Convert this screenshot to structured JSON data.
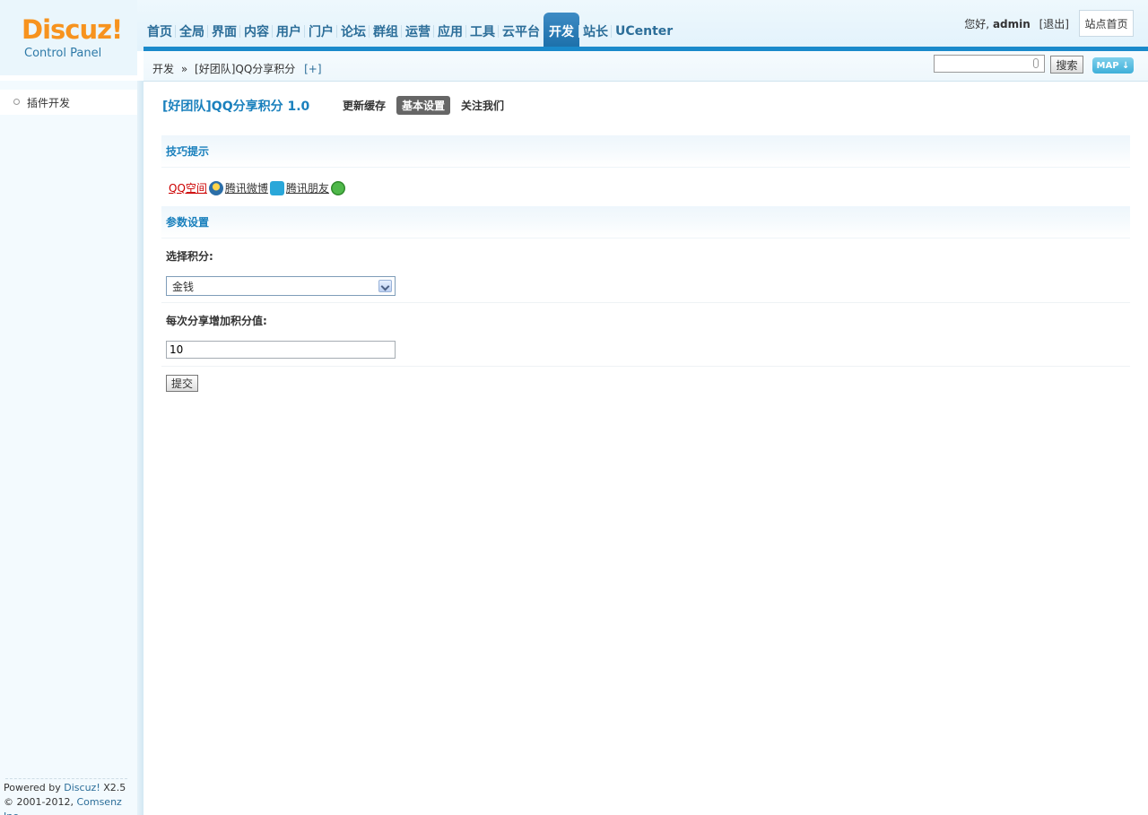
{
  "logo": {
    "name": "Discuz!",
    "subtitle": "Control Panel"
  },
  "nav": {
    "items": [
      "首页",
      "全局",
      "界面",
      "内容",
      "用户",
      "门户",
      "论坛",
      "群组",
      "运营",
      "应用",
      "工具",
      "云平台",
      "开发",
      "站长",
      "UCenter"
    ],
    "active_index": 12
  },
  "user": {
    "greeting": "您好,",
    "username": "admin",
    "logout": "[退出]",
    "site_home": "站点首页"
  },
  "breadcrumb": {
    "parent": "开发",
    "separator": "»",
    "current": "[好团队]QQ分享积分",
    "add": "[+]"
  },
  "search": {
    "value": "",
    "button": "搜索",
    "map_button": "MAP ↓"
  },
  "sidebar": {
    "items": [
      {
        "label": "插件开发"
      }
    ]
  },
  "footer": {
    "powered_prefix": "Powered by ",
    "powered_link": "Discuz!",
    "version": " X2.5",
    "copyright_prefix": "© 2001-2012, ",
    "copyright_link": "Comsenz Inc."
  },
  "plugin": {
    "title": "[好团队]QQ分享积分 1.0",
    "tabs": [
      {
        "label": "更新缓存"
      },
      {
        "label": "基本设置"
      },
      {
        "label": "关注我们"
      }
    ],
    "active_tab": 1
  },
  "tips": {
    "heading": "技巧提示",
    "links": [
      {
        "label": "QQ空间"
      },
      {
        "label": "腾讯微博",
        "icon": "weibo-icon"
      },
      {
        "label": "腾讯朋友",
        "icon": "pengyou-icon"
      }
    ],
    "trailing_icon": "clover-icon"
  },
  "params": {
    "heading": "参数设置",
    "credit_label": "选择积分:",
    "credit_selected": "金钱",
    "add_label": "每次分享增加积分值:",
    "add_value": "10",
    "submit": "提交"
  }
}
